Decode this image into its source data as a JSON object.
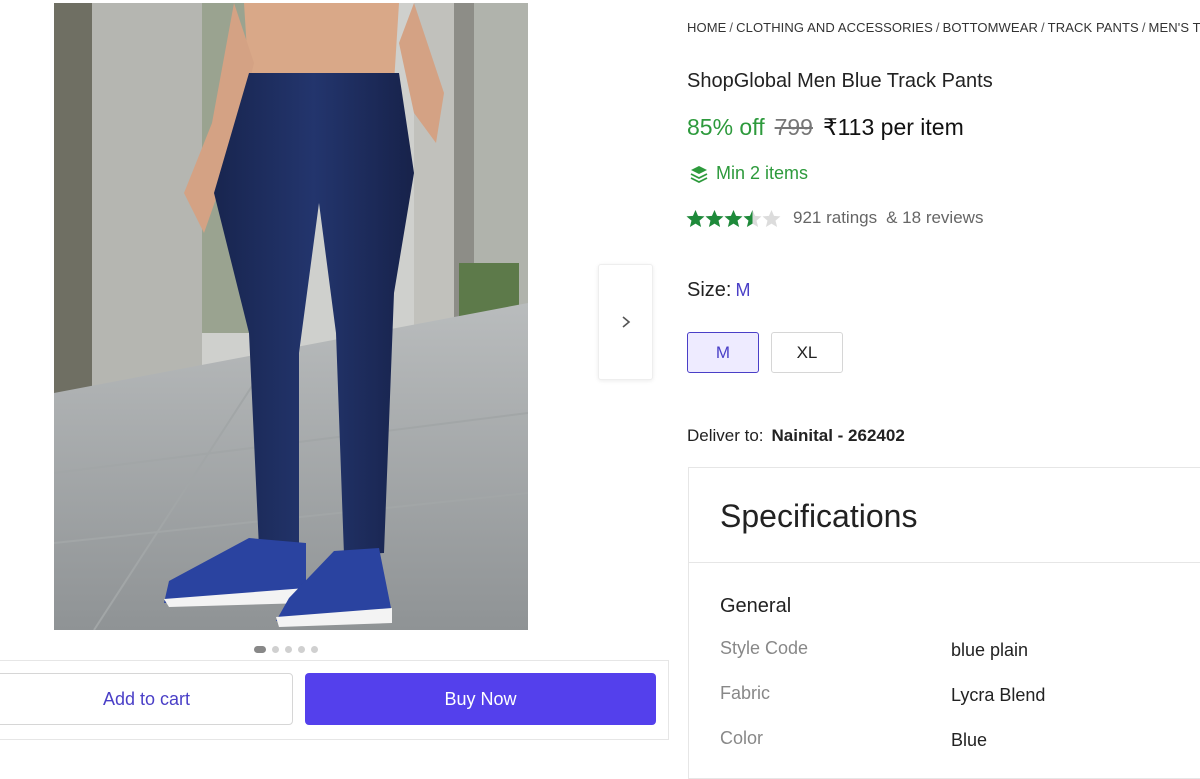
{
  "breadcrumb": [
    {
      "label": "HOME"
    },
    {
      "label": "CLOTHING AND ACCESSORIES"
    },
    {
      "label": "BOTTOMWEAR"
    },
    {
      "label": "TRACK PANTS"
    },
    {
      "label": "MEN'S TRACK PANTS"
    }
  ],
  "breadcrumb_separator": "/",
  "product": {
    "title": "ShopGlobal Men Blue Track Pants",
    "discount": "85% off",
    "mrp": "799",
    "price": "₹113 per item",
    "min_items": "Min 2 items",
    "rating_value": 3.5,
    "rating_max": 5,
    "ratings_text": "921 ratings",
    "reviews_text": "& 18 reviews",
    "image_count": 5,
    "active_image": 0
  },
  "size": {
    "label": "Size:",
    "selected": "M",
    "options": [
      "M",
      "XL"
    ]
  },
  "delivery": {
    "label": "Deliver to:",
    "location": "Nainital - 262402"
  },
  "actions": {
    "add_to_cart": "Add to cart",
    "buy_now": "Buy Now"
  },
  "specifications": {
    "title": "Specifications",
    "group": "General",
    "rows": [
      {
        "key": "Style Code",
        "value": "blue plain"
      },
      {
        "key": "Fabric",
        "value": "Lycra Blend"
      },
      {
        "key": "Color",
        "value": "Blue"
      }
    ]
  },
  "colors": {
    "accent": "#5440ec",
    "accent_text": "#4a3fc7",
    "discount_green": "#2d9a3c",
    "star_green": "#1e8a3a"
  },
  "icons": {
    "next": "chevron-right-icon",
    "min_items": "layers-icon",
    "rating": "star-icon"
  }
}
